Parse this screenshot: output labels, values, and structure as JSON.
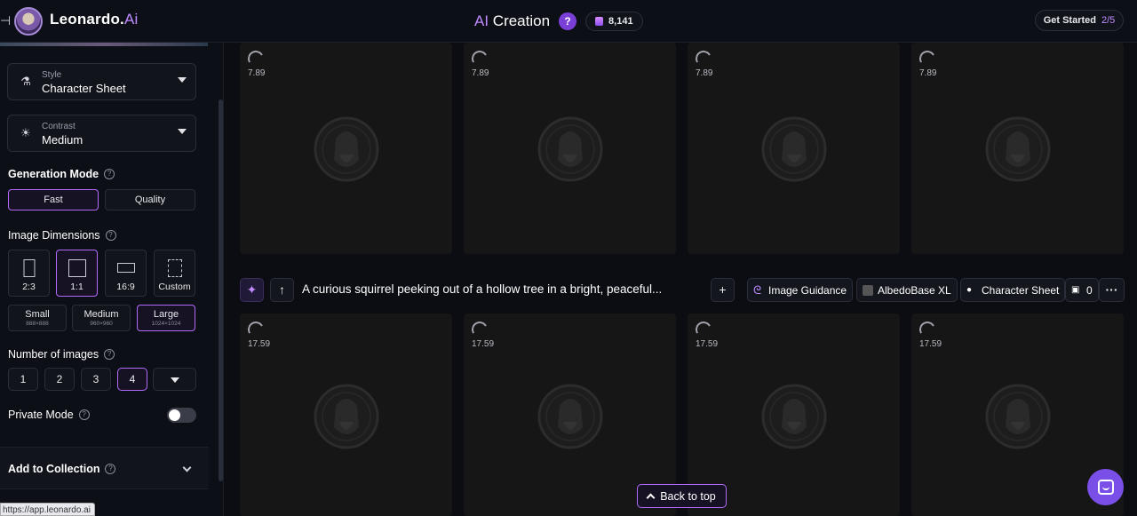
{
  "header": {
    "collapse_icon": "⊣",
    "logo_text": "Leonardo.",
    "logo_ai": "Ai",
    "title_prefix": "AI",
    "title": " Creation",
    "help": "?",
    "token_count": "8,141",
    "get_started_label": "Get Started",
    "get_started_progress": "2/5"
  },
  "sidebar": {
    "style": {
      "label": "Style",
      "value": "Character Sheet",
      "icon": "flask-icon"
    },
    "contrast": {
      "label": "Contrast",
      "value": "Medium",
      "icon": "sun-icon"
    },
    "generation_mode": {
      "label": "Generation Mode",
      "options": [
        "Fast",
        "Quality"
      ],
      "selected": "Fast"
    },
    "image_dimensions": {
      "label": "Image Dimensions",
      "ratios": [
        "2:3",
        "1:1",
        "16:9",
        "Custom"
      ],
      "selected_ratio": "1:1",
      "sizes": [
        {
          "name": "Small",
          "dims": "888×888"
        },
        {
          "name": "Medium",
          "dims": "960×960"
        },
        {
          "name": "Large",
          "dims": "1024×1024"
        }
      ],
      "selected_size": "Large"
    },
    "number_of_images": {
      "label": "Number of images",
      "options": [
        "1",
        "2",
        "3",
        "4"
      ],
      "selected": "4"
    },
    "private_mode": {
      "label": "Private Mode",
      "enabled": false
    },
    "add_to_collection": {
      "label": "Add to Collection"
    },
    "url_tooltip": "https://app.leonardo.ai"
  },
  "grid": {
    "row1_eta": [
      "7.89",
      "7.89",
      "7.89",
      "7.89"
    ],
    "row2_eta": [
      "17.59",
      "17.59",
      "17.59",
      "17.59"
    ]
  },
  "prompt_bar": {
    "prompt": "A curious squirrel peeking out of a hollow tree in a bright, peaceful...",
    "image_guidance": "Image Guidance",
    "model": "AlbedoBase XL",
    "style": "Character Sheet",
    "image_count": "0",
    "more": "···"
  },
  "back_to_top": "Back to top",
  "colors": {
    "accent": "#b36bff",
    "brand": "#c08bff",
    "chat": "#7a4fe8"
  }
}
